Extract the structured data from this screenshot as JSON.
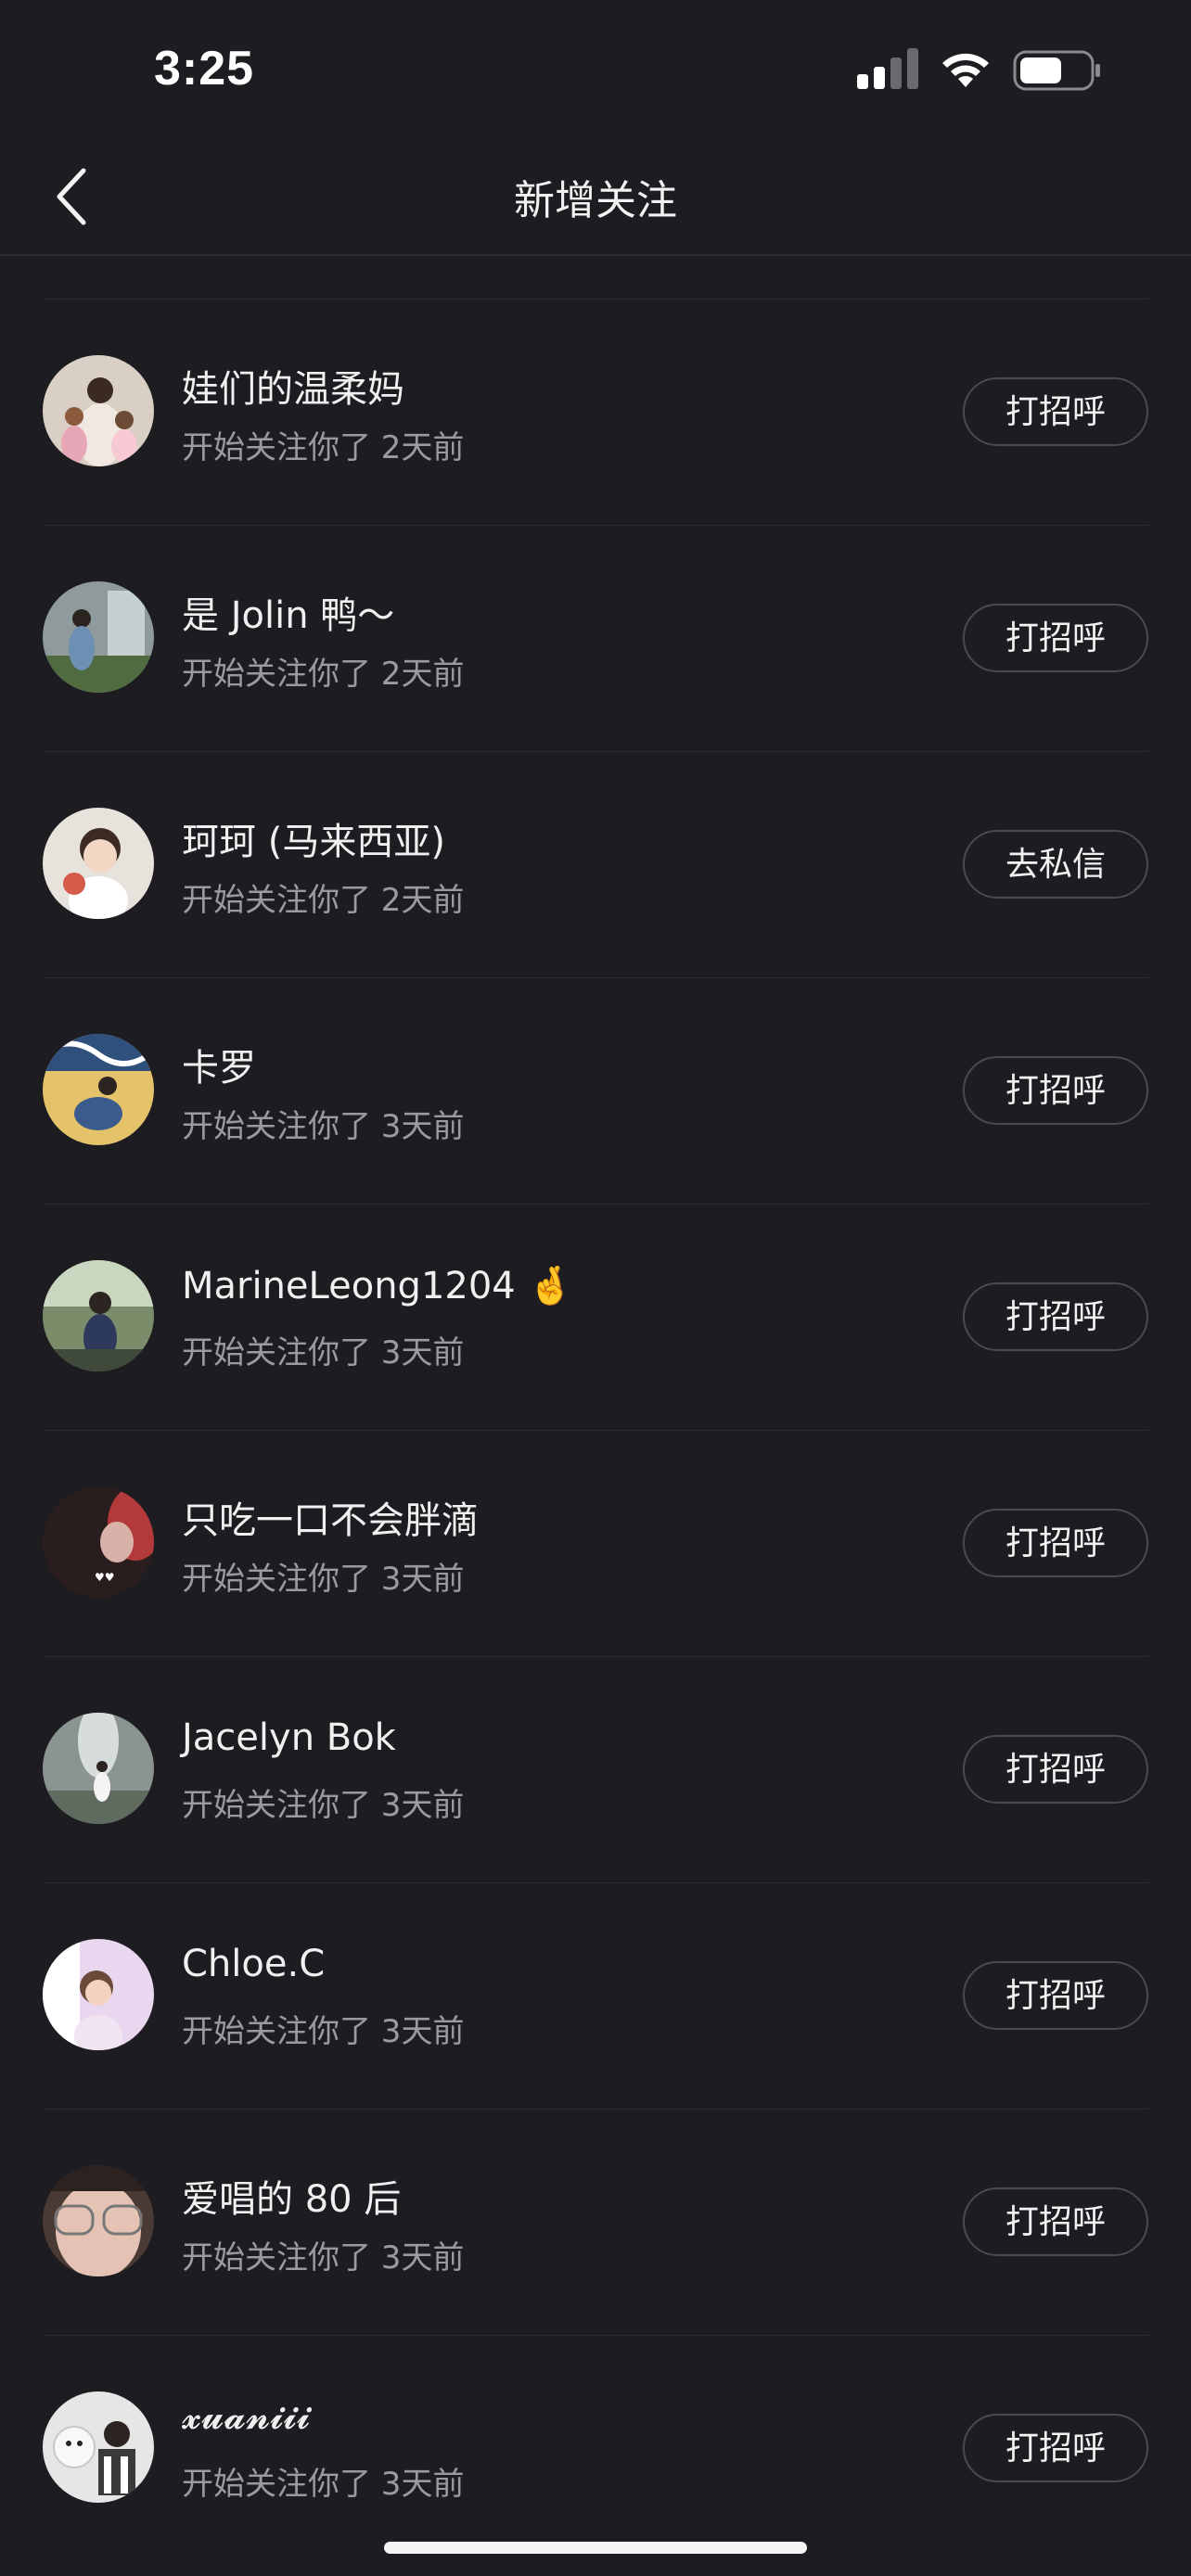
{
  "status": {
    "time": "3:25"
  },
  "header": {
    "title": "新增关注"
  },
  "colors": {
    "background": "#1c1c21",
    "subtext": "#9a9aa0",
    "button_border": "#4a4a50"
  },
  "followers": [
    {
      "name": "娃们的温柔妈",
      "subtitle": "开始关注你了 2天前",
      "action": "打招呼",
      "avatar": "avatar-mother-kids"
    },
    {
      "name": "是 Jolin 鸭～",
      "subtitle": "开始关注你了 2天前",
      "action": "打招呼",
      "avatar": "avatar-jolin"
    },
    {
      "name": "珂珂 (马来西亚)",
      "subtitle": "开始关注你了 2天前",
      "action": "去私信",
      "avatar": "avatar-child"
    },
    {
      "name": "卡罗",
      "subtitle": "开始关注你了 3天前",
      "action": "打招呼",
      "avatar": "avatar-karo"
    },
    {
      "name": "MarineLeong1204 🤞",
      "subtitle": "开始关注你了 3天前",
      "action": "打招呼",
      "avatar": "avatar-marine"
    },
    {
      "name": "只吃一口不会胖滴",
      "subtitle": "开始关注你了 3天前",
      "action": "打招呼",
      "avatar": "avatar-dark"
    },
    {
      "name": "Jacelyn Bok",
      "subtitle": "开始关注你了 3天前",
      "action": "打招呼",
      "avatar": "avatar-fountain"
    },
    {
      "name": "Chloe.C",
      "subtitle": "开始关注你了 3天前",
      "action": "打招呼",
      "avatar": "avatar-chloe"
    },
    {
      "name": "爱唱的 80 后",
      "subtitle": "开始关注你了 3天前",
      "action": "打招呼",
      "avatar": "avatar-glasses"
    },
    {
      "name": "𝔁𝓾𝓪𝓷𝓲𝓲𝓲",
      "subtitle": "开始关注你了 3天前",
      "action": "打招呼",
      "avatar": "avatar-xuaniii"
    }
  ]
}
